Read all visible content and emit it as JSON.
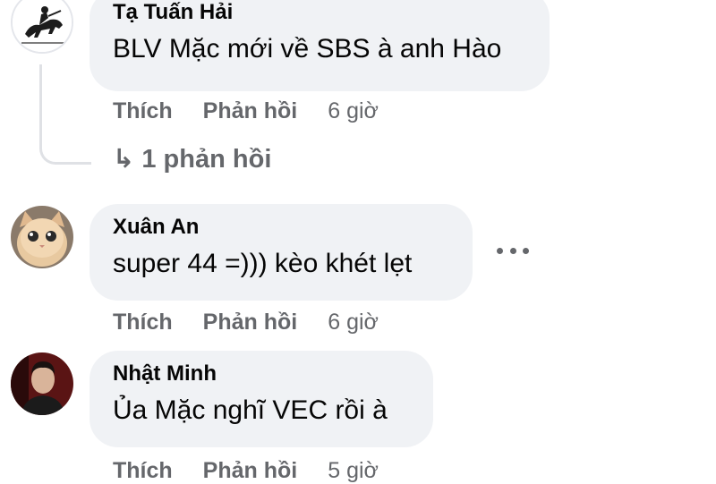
{
  "comments": [
    {
      "author": "Tạ Tuấn Hải",
      "text": "BLV Mặc mới về SBS à anh Hào",
      "like": "Thích",
      "reply": "Phản hồi",
      "time": "6 giờ",
      "replies_link": "1 phản hồi"
    },
    {
      "author": "Xuân An",
      "text": "super 44 =))) kèo khét lẹt",
      "like": "Thích",
      "reply": "Phản hồi",
      "time": "6 giờ"
    },
    {
      "author": "Nhật Minh",
      "text": "Ủa Mặc nghĩ VEC rồi à",
      "like": "Thích",
      "reply": "Phản hồi",
      "time": "5 giờ"
    }
  ],
  "icons": {
    "reply_arrow": "↳",
    "more": "more-options-icon"
  },
  "colors": {
    "bubble": "#f0f2f5",
    "secondary_text": "#65676b",
    "primary_text": "#050505"
  }
}
